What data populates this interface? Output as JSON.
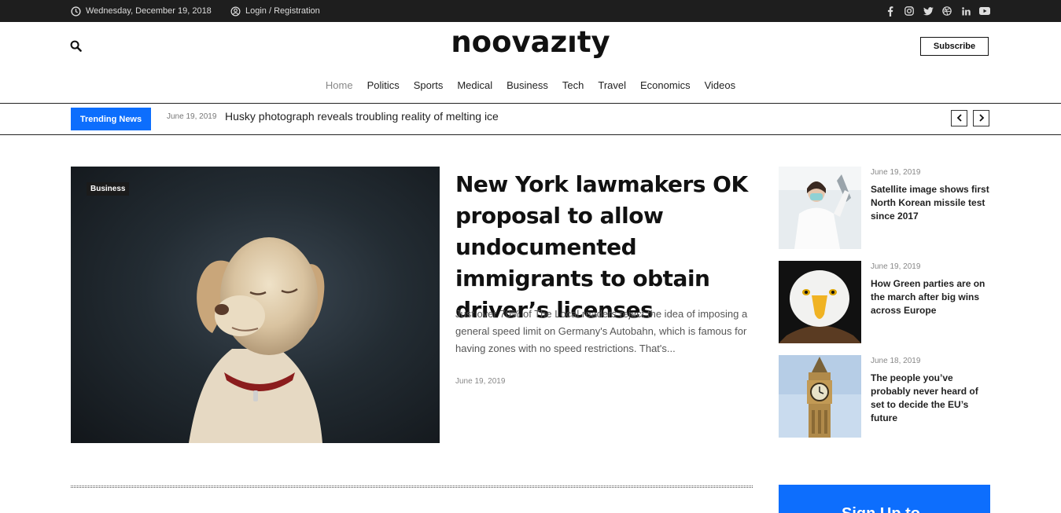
{
  "topbar": {
    "date": "Wednesday, December 19, 2018",
    "login": "Login / Registration",
    "social_icons": [
      "facebook-icon",
      "instagram-icon",
      "twitter-icon",
      "dribbble-icon",
      "linkedin-icon",
      "youtube-icon"
    ]
  },
  "header": {
    "logo": "noovazıty",
    "subscribe_label": "Subscribe"
  },
  "nav": {
    "items": [
      "Home",
      "Politics",
      "Sports",
      "Medical",
      "Business",
      "Tech",
      "Travel",
      "Economics",
      "Videos"
    ],
    "active": "Home"
  },
  "trending": {
    "badge": "Trending News",
    "date": "June 19, 2019",
    "title": "Husky photograph reveals troubling reality of melting ice"
  },
  "featured": {
    "category": "Business",
    "title": "New York lawmakers OK proposal to allow undocumented immigrants to obtain driver’s licenses",
    "excerpt": "Just over 70% of The Local readers reject the idea of imposing a general speed limit on Germany's Autobahn, which is famous for having zones with no speed restrictions. That's...",
    "date": "June 19, 2019"
  },
  "side_posts": [
    {
      "date": "June 19, 2019",
      "title": "Satellite image shows first North Korean missile test since 2017"
    },
    {
      "date": "June 19, 2019",
      "title": "How Green parties are on the march after big wins across Europe"
    },
    {
      "date": "June 18, 2019",
      "title": "The people you’ve probably never heard of set to decide the EU’s future"
    }
  ],
  "signup": {
    "label": "Sign Up to"
  },
  "colors": {
    "accent": "#0d6efd",
    "topbar_bg": "#1e1e1e"
  }
}
